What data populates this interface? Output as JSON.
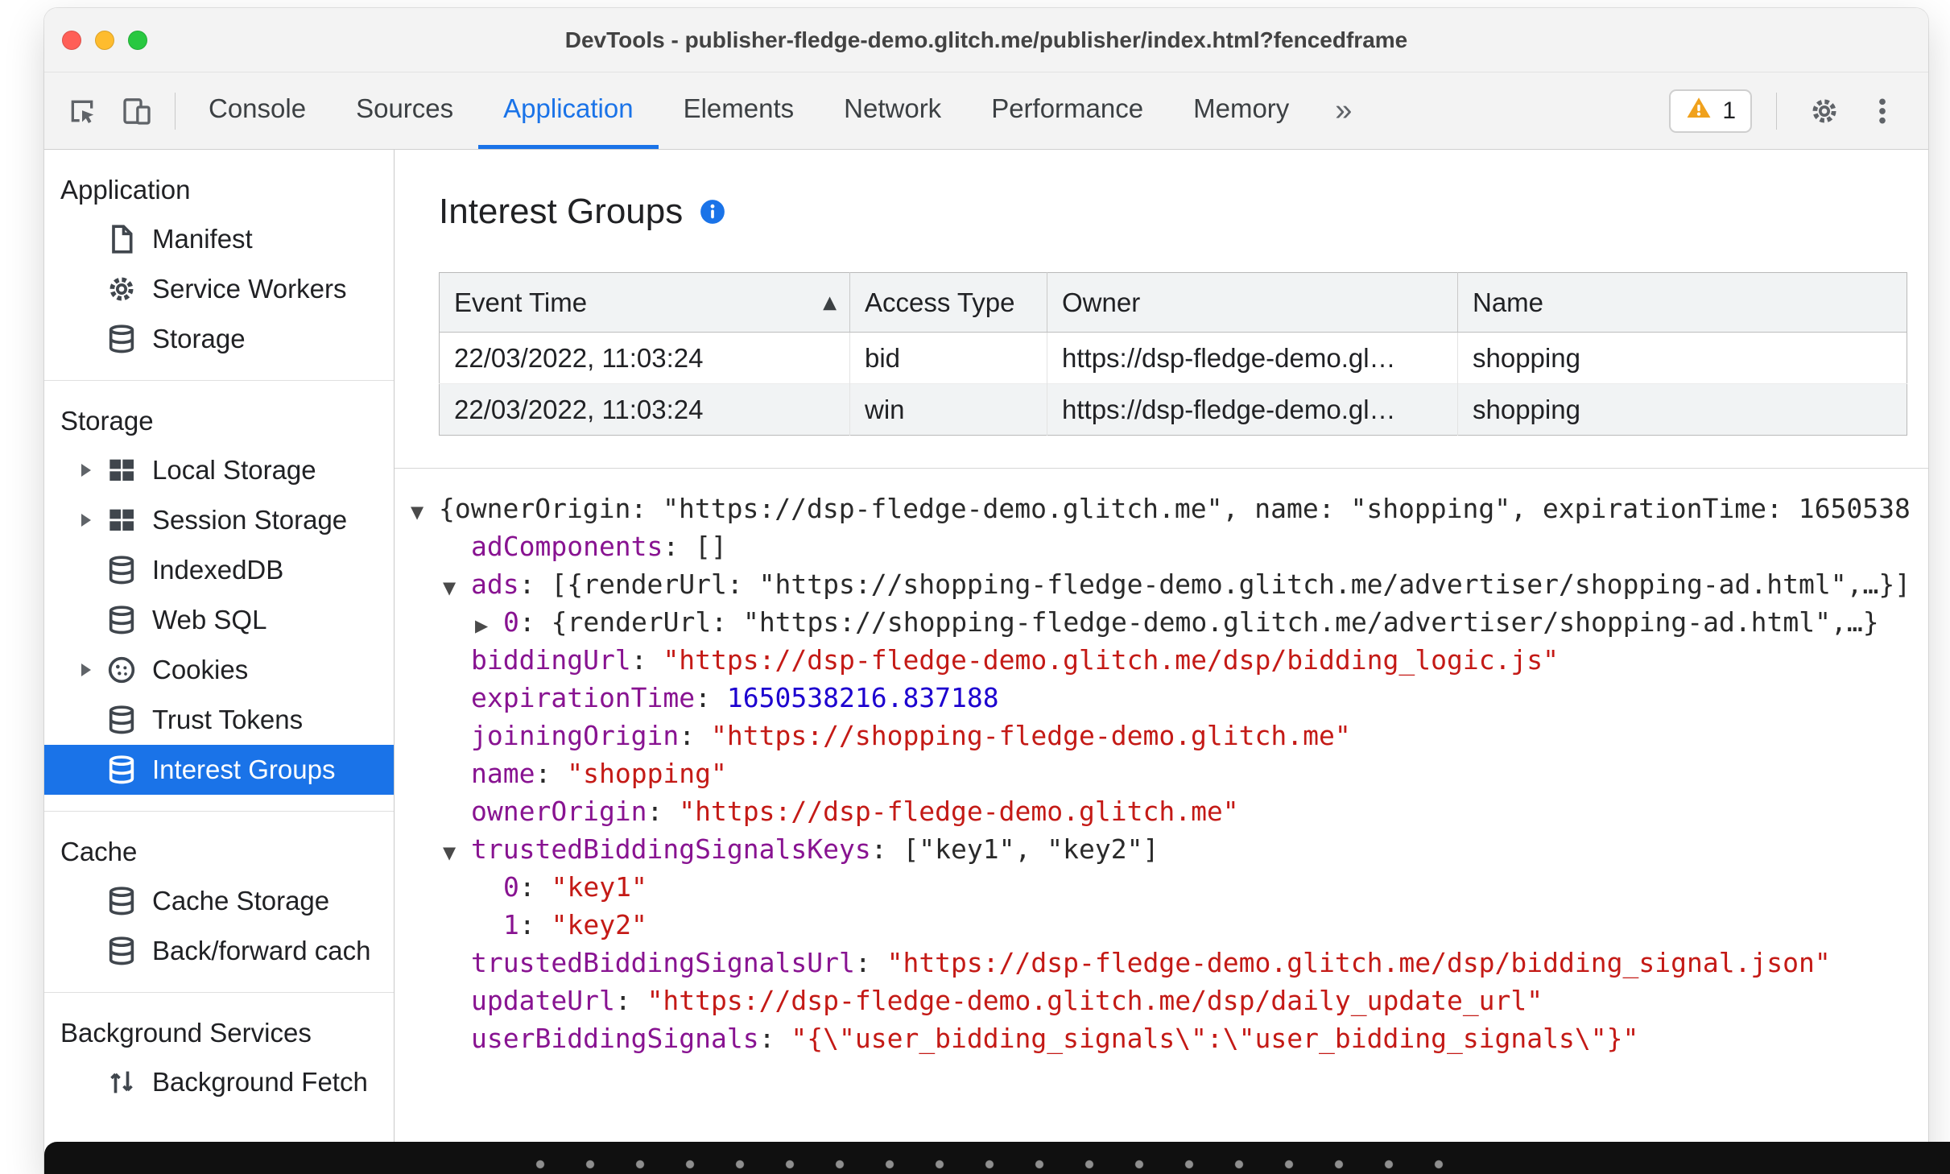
{
  "colors": {
    "accent": "#1a73e8",
    "selection_background": "#1a73e8",
    "warning": "#f0a11c"
  },
  "tree_colors": {
    "plain": "#2a2a2a",
    "key": "#881391",
    "string": "#c41a16",
    "number": "#1c00cf"
  },
  "window": {
    "title": "DevTools - publisher-fledge-demo.glitch.me/publisher/index.html?fencedframe"
  },
  "toolbar": {
    "left_icons": [
      {
        "name": "inspect-icon"
      },
      {
        "name": "device-toolbar-icon"
      }
    ],
    "tabs": [
      {
        "label": "Console",
        "active": false
      },
      {
        "label": "Sources",
        "active": false
      },
      {
        "label": "Application",
        "active": true
      },
      {
        "label": "Elements",
        "active": false
      },
      {
        "label": "Network",
        "active": false
      },
      {
        "label": "Performance",
        "active": false
      },
      {
        "label": "Memory",
        "active": false
      }
    ],
    "more_tabs_label": "»",
    "warning_badge": {
      "count": "1"
    },
    "right_icons": [
      {
        "name": "settings-gear-icon"
      },
      {
        "name": "menu-kebab-icon"
      }
    ]
  },
  "sidebar": {
    "sections": [
      {
        "header": "Application",
        "items": [
          {
            "label": "Manifest",
            "icon": "document-icon"
          },
          {
            "label": "Service Workers",
            "icon": "gear-icon"
          },
          {
            "label": "Storage",
            "icon": "database-icon"
          }
        ]
      },
      {
        "header": "Storage",
        "items": [
          {
            "label": "Local Storage",
            "icon": "table-icon",
            "expandable": true
          },
          {
            "label": "Session Storage",
            "icon": "table-icon",
            "expandable": true
          },
          {
            "label": "IndexedDB",
            "icon": "database-icon"
          },
          {
            "label": "Web SQL",
            "icon": "database-icon"
          },
          {
            "label": "Cookies",
            "icon": "cookie-icon",
            "expandable": true
          },
          {
            "label": "Trust Tokens",
            "icon": "database-icon"
          },
          {
            "label": "Interest Groups",
            "icon": "database-icon",
            "selected": true
          }
        ]
      },
      {
        "header": "Cache",
        "items": [
          {
            "label": "Cache Storage",
            "icon": "database-icon"
          },
          {
            "label": "Back/forward cach",
            "icon": "database-icon"
          }
        ]
      },
      {
        "header": "Background Services",
        "items": [
          {
            "label": "Background Fetch",
            "icon": "fetch-icon"
          }
        ]
      }
    ]
  },
  "main": {
    "title": "Interest Groups",
    "table": {
      "columns": [
        "Event Time",
        "Access Type",
        "Owner",
        "Name"
      ],
      "sort": {
        "column": "Event Time",
        "direction": "asc"
      },
      "rows": [
        [
          "22/03/2022, 11:03:24",
          "bid",
          "https://dsp-fledge-demo.gl…",
          "shopping"
        ],
        [
          "22/03/2022, 11:03:24",
          "win",
          "https://dsp-fledge-demo.gl…",
          "shopping"
        ]
      ]
    },
    "tree": {
      "lines": [
        {
          "level": 0,
          "expander": "open",
          "segments": [
            [
              "plain",
              "{ownerOrigin: \"https://dsp-fledge-demo.glitch.me\", name: \"shopping\", expirationTime: 1650538"
            ]
          ]
        },
        {
          "level": 1,
          "expander": "none",
          "segments": [
            [
              "key",
              "adComponents"
            ],
            [
              "plain",
              ": []"
            ]
          ]
        },
        {
          "level": 1,
          "expander": "open",
          "segments": [
            [
              "key",
              "ads"
            ],
            [
              "plain",
              ": [{renderUrl: \"https://shopping-fledge-demo.glitch.me/advertiser/shopping-ad.html\",…}]"
            ]
          ]
        },
        {
          "level": 2,
          "expander": "closed",
          "segments": [
            [
              "key",
              "0"
            ],
            [
              "plain",
              ": {renderUrl: \"https://shopping-fledge-demo.glitch.me/advertiser/shopping-ad.html\",…}"
            ]
          ]
        },
        {
          "level": 1,
          "expander": "none",
          "segments": [
            [
              "key",
              "biddingUrl"
            ],
            [
              "plain",
              ": "
            ],
            [
              "string",
              "\"https://dsp-fledge-demo.glitch.me/dsp/bidding_logic.js\""
            ]
          ]
        },
        {
          "level": 1,
          "expander": "none",
          "segments": [
            [
              "key",
              "expirationTime"
            ],
            [
              "plain",
              ": "
            ],
            [
              "number",
              "1650538216.837188"
            ]
          ]
        },
        {
          "level": 1,
          "expander": "none",
          "segments": [
            [
              "key",
              "joiningOrigin"
            ],
            [
              "plain",
              ": "
            ],
            [
              "string",
              "\"https://shopping-fledge-demo.glitch.me\""
            ]
          ]
        },
        {
          "level": 1,
          "expander": "none",
          "segments": [
            [
              "key",
              "name"
            ],
            [
              "plain",
              ": "
            ],
            [
              "string",
              "\"shopping\""
            ]
          ]
        },
        {
          "level": 1,
          "expander": "none",
          "segments": [
            [
              "key",
              "ownerOrigin"
            ],
            [
              "plain",
              ": "
            ],
            [
              "string",
              "\"https://dsp-fledge-demo.glitch.me\""
            ]
          ]
        },
        {
          "level": 1,
          "expander": "open",
          "segments": [
            [
              "key",
              "trustedBiddingSignalsKeys"
            ],
            [
              "plain",
              ": [\"key1\", \"key2\"]"
            ]
          ]
        },
        {
          "level": 2,
          "expander": "none",
          "segments": [
            [
              "key",
              "0"
            ],
            [
              "plain",
              ": "
            ],
            [
              "string",
              "\"key1\""
            ]
          ]
        },
        {
          "level": 2,
          "expander": "none",
          "segments": [
            [
              "key",
              "1"
            ],
            [
              "plain",
              ": "
            ],
            [
              "string",
              "\"key2\""
            ]
          ]
        },
        {
          "level": 1,
          "expander": "none",
          "segments": [
            [
              "key",
              "trustedBiddingSignalsUrl"
            ],
            [
              "plain",
              ": "
            ],
            [
              "string",
              "\"https://dsp-fledge-demo.glitch.me/dsp/bidding_signal.json\""
            ]
          ]
        },
        {
          "level": 1,
          "expander": "none",
          "segments": [
            [
              "key",
              "updateUrl"
            ],
            [
              "plain",
              ": "
            ],
            [
              "string",
              "\"https://dsp-fledge-demo.glitch.me/dsp/daily_update_url\""
            ]
          ]
        },
        {
          "level": 1,
          "expander": "none",
          "segments": [
            [
              "key",
              "userBiddingSignals"
            ],
            [
              "plain",
              ": "
            ],
            [
              "string",
              "\"{\\\"user_bidding_signals\\\":\\\"user_bidding_signals\\\"}\""
            ]
          ]
        }
      ]
    }
  }
}
